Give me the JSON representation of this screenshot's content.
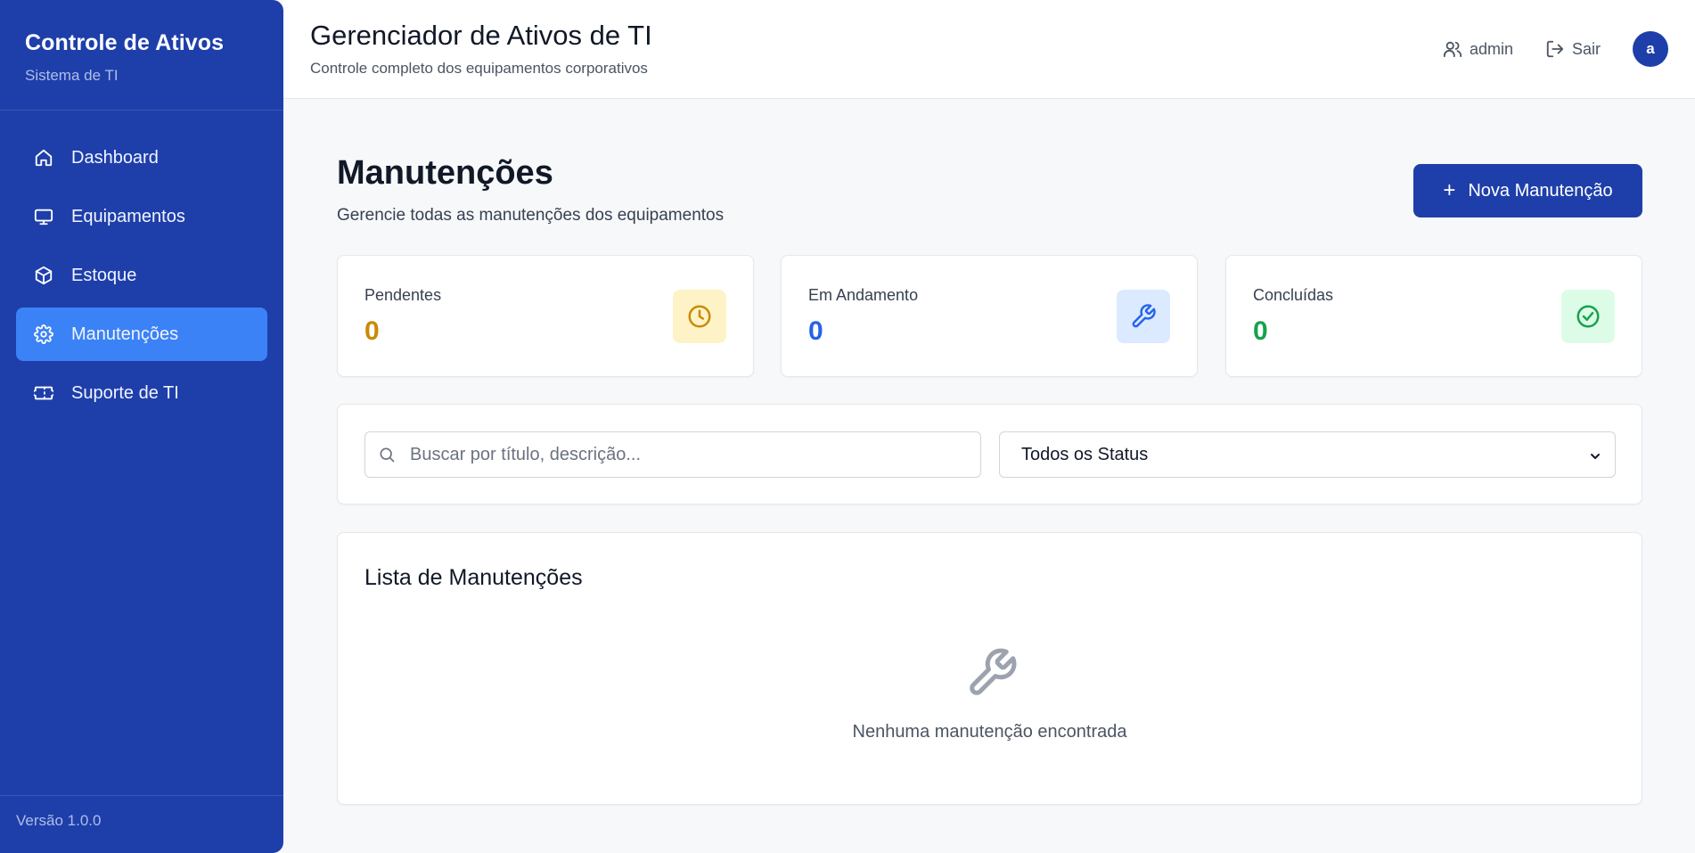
{
  "sidebar": {
    "title": "Controle de Ativos",
    "subtitle": "Sistema de TI",
    "items": [
      {
        "label": "Dashboard",
        "icon": "home-icon"
      },
      {
        "label": "Equipamentos",
        "icon": "monitor-icon"
      },
      {
        "label": "Estoque",
        "icon": "package-icon"
      },
      {
        "label": "Manutenções",
        "icon": "gear-icon",
        "active": true
      },
      {
        "label": "Suporte de TI",
        "icon": "ticket-icon"
      }
    ],
    "version": "Versão 1.0.0"
  },
  "header": {
    "title": "Gerenciador de Ativos de TI",
    "subtitle": "Controle completo dos equipamentos corporativos",
    "user": "admin",
    "logout": "Sair",
    "avatar_initial": "a"
  },
  "main": {
    "title": "Manutenções",
    "subtitle": "Gerencie todas as manutenções dos equipamentos",
    "new_button": "Nova Manutenção",
    "stats": [
      {
        "label": "Pendentes",
        "value": "0",
        "color": "#ca8a04",
        "icon": "clock-icon",
        "icon_bg": "#fef3c7"
      },
      {
        "label": "Em Andamento",
        "value": "0",
        "color": "#2563eb",
        "icon": "wrench-icon",
        "icon_bg": "#dbeafe"
      },
      {
        "label": "Concluídas",
        "value": "0",
        "color": "#16a34a",
        "icon": "check-circle-icon",
        "icon_bg": "#dcfce7"
      }
    ],
    "search": {
      "placeholder": "Buscar por título, descrição...",
      "value": ""
    },
    "status_filter": {
      "selected": "Todos os Status"
    },
    "list": {
      "title": "Lista de Manutenções",
      "empty_text": "Nenhuma manutenção encontrada"
    }
  }
}
